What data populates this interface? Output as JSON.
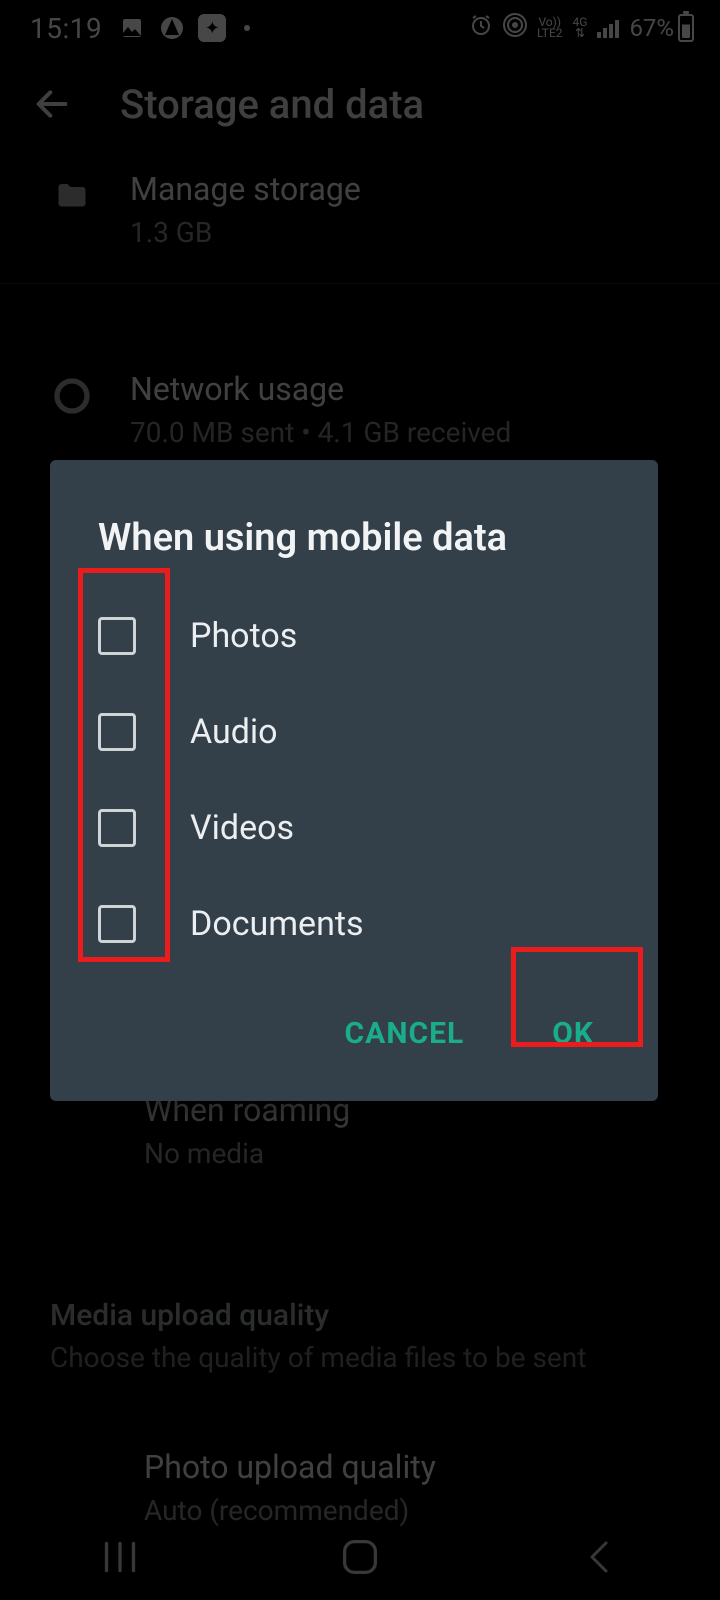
{
  "status": {
    "time": "15:19",
    "battery_pct": "67%"
  },
  "appbar": {
    "title": "Storage and data"
  },
  "rows": {
    "manage_storage": {
      "title": "Manage storage",
      "sub": "1.3 GB"
    },
    "network_usage": {
      "title": "Network usage",
      "sub": "70.0 MB sent • 4.1 GB received"
    },
    "roaming": {
      "title": "When roaming",
      "sub": "No media"
    }
  },
  "sections": {
    "media_quality": {
      "title": "Media upload quality",
      "sub": "Choose the quality of media files to be sent"
    }
  },
  "photo_quality": {
    "title": "Photo upload quality",
    "sub": "Auto (recommended)"
  },
  "dialog": {
    "title": "When using mobile data",
    "options": {
      "photos": "Photos",
      "audio": "Audio",
      "videos": "Videos",
      "documents": "Documents"
    },
    "cancel": "CANCEL",
    "ok": "OK"
  }
}
